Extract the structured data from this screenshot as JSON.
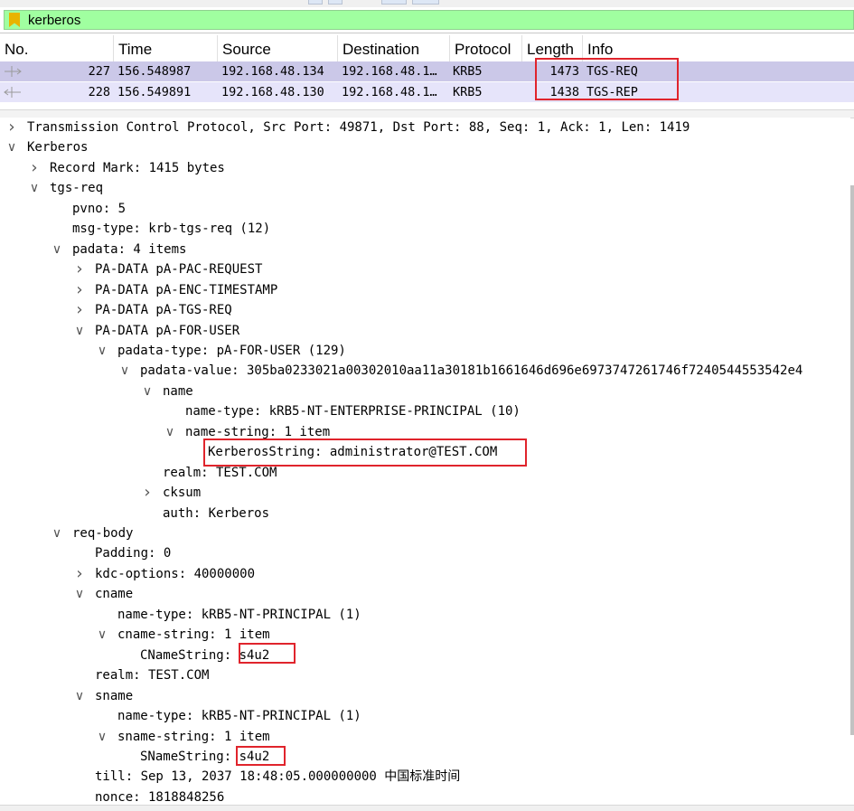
{
  "filter": {
    "text": "kerberos",
    "icon": "bookmark-icon"
  },
  "packet_list": {
    "columns": [
      "No.",
      "Time",
      "Source",
      "Destination",
      "Protocol",
      "Length",
      "Info"
    ],
    "rows": [
      {
        "no": "227",
        "time": "156.548987",
        "source": "192.168.48.134",
        "destination": "192.168.48.1…",
        "protocol": "KRB5",
        "length": "1473",
        "info": "TGS-REQ",
        "direction": "request"
      },
      {
        "no": "228",
        "time": "156.549891",
        "source": "192.168.48.130",
        "destination": "192.168.48.1…",
        "protocol": "KRB5",
        "length": "1438",
        "info": "TGS-REP",
        "direction": "response"
      }
    ]
  },
  "details": {
    "lines": [
      {
        "text": "Transmission Control Protocol, Src Port: 49871, Dst Port: 88, Seq: 1, Ack: 1, Len: 1419",
        "expander": "collapsed"
      },
      {
        "text": "Kerberos",
        "expander": "expanded"
      },
      {
        "text": "Record Mark: 1415 bytes",
        "expander": "collapsed"
      },
      {
        "text": "tgs-req",
        "expander": "expanded"
      },
      {
        "text": "pvno: 5",
        "expander": "none"
      },
      {
        "text": "msg-type: krb-tgs-req (12)",
        "expander": "none"
      },
      {
        "text": "padata: 4 items",
        "expander": "expanded"
      },
      {
        "text": "PA-DATA pA-PAC-REQUEST",
        "expander": "collapsed"
      },
      {
        "text": "PA-DATA pA-ENC-TIMESTAMP",
        "expander": "collapsed"
      },
      {
        "text": "PA-DATA pA-TGS-REQ",
        "expander": "collapsed"
      },
      {
        "text": "PA-DATA pA-FOR-USER",
        "expander": "expanded"
      },
      {
        "text": "padata-type: pA-FOR-USER (129)",
        "expander": "expanded"
      },
      {
        "text": "padata-value: 305ba0233021a00302010aa11a30181b1661646d696e6973747261746f7240544553542e4",
        "expander": "expanded"
      },
      {
        "text": "name",
        "expander": "expanded"
      },
      {
        "text": "name-type: kRB5-NT-ENTERPRISE-PRINCIPAL (10)",
        "expander": "none"
      },
      {
        "text": "name-string: 1 item",
        "expander": "expanded"
      },
      {
        "text": "KerberosString: administrator@TEST.COM",
        "expander": "none"
      },
      {
        "text": "realm: TEST.COM",
        "expander": "none"
      },
      {
        "text": "cksum",
        "expander": "collapsed"
      },
      {
        "text": "auth: Kerberos",
        "expander": "none"
      },
      {
        "text": "req-body",
        "expander": "expanded"
      },
      {
        "text": "Padding: 0",
        "expander": "none"
      },
      {
        "text": "kdc-options: 40000000",
        "expander": "collapsed"
      },
      {
        "text": "cname",
        "expander": "expanded"
      },
      {
        "text": "name-type: kRB5-NT-PRINCIPAL (1)",
        "expander": "none"
      },
      {
        "text": "cname-string: 1 item",
        "expander": "expanded"
      },
      {
        "text": "CNameString: s4u2",
        "expander": "none"
      },
      {
        "text": "realm: TEST.COM",
        "expander": "none"
      },
      {
        "text": "sname",
        "expander": "expanded"
      },
      {
        "text": "name-type: kRB5-NT-PRINCIPAL (1)",
        "expander": "none"
      },
      {
        "text": "sname-string: 1 item",
        "expander": "expanded"
      },
      {
        "text": "SNameString: s4u2",
        "expander": "none"
      },
      {
        "text": "till: Sep 13, 2037 18:48:05.000000000 中国标准时间",
        "expander": "none"
      },
      {
        "text": "nonce: 1818848256",
        "expander": "none"
      }
    ]
  },
  "colors": {
    "filter_valid": "#a0ffa0",
    "selected_row": "#cbc8e8",
    "alt_row": "#e6e4fa",
    "annotation": "#e0242c"
  }
}
